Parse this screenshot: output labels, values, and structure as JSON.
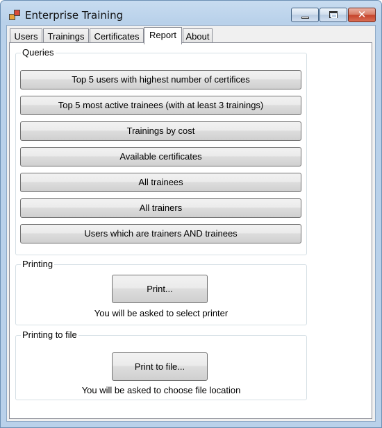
{
  "window": {
    "title": "Enterprise Training",
    "controls": {
      "minimize": "minimize",
      "maximize": "maximize",
      "close": "✕"
    }
  },
  "tabs": [
    {
      "label": "Users"
    },
    {
      "label": "Trainings"
    },
    {
      "label": "Certificates"
    },
    {
      "label": "Report",
      "selected": true
    },
    {
      "label": "About"
    }
  ],
  "report": {
    "queries": {
      "title": "Queries",
      "buttons": [
        "Top 5 users with highest number of certifices",
        "Top 5 most active trainees (with at least 3 trainings)",
        "Trainings by cost",
        "Available certificates",
        "All trainees",
        "All trainers",
        "Users which are trainers AND trainees"
      ]
    },
    "printing": {
      "title": "Printing",
      "button": "Print...",
      "hint": "You will be asked to select printer"
    },
    "printing_to_file": {
      "title": "Printing to file",
      "button": "Print to file...",
      "hint": "You will be asked to choose file location"
    }
  },
  "colors": {
    "frame": "#b9d1ea",
    "close_button": "#c5422a",
    "page_background": "#ffffff"
  }
}
